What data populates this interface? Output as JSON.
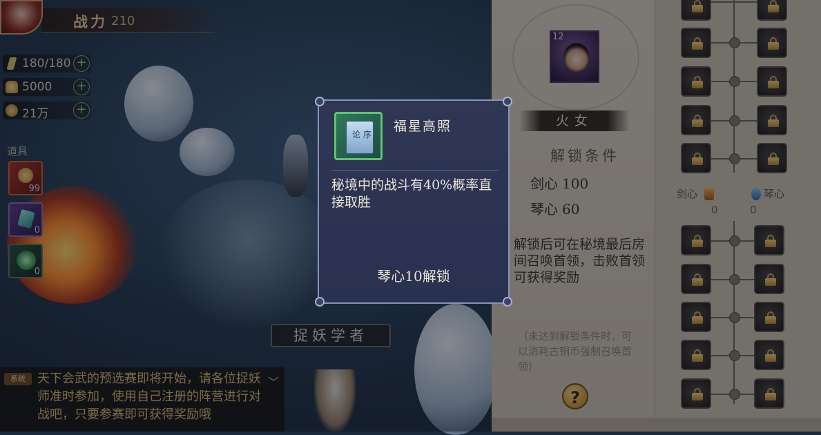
{
  "hud": {
    "power_label": "战力",
    "power_value": "210",
    "stamina": "180/180",
    "gold": "5000",
    "coins": "21万",
    "plus": "+"
  },
  "items": {
    "label": "道具",
    "slots": [
      {
        "count": "99"
      },
      {
        "count": "0"
      },
      {
        "count": "0"
      }
    ]
  },
  "npc": {
    "name": "捉妖学者"
  },
  "chat": {
    "tag": "系统",
    "text": "天下会武的预选赛即将开始，请各位捉妖师准时参加，使用自己注册的阵营进行对战吧，只要参赛即可获得奖励哦",
    "collapse": "﹀"
  },
  "panel": {
    "boss_level": "12",
    "boss_name": "火女",
    "unlock_title": "解锁条件",
    "requirements": [
      {
        "name": "剑心",
        "value": "100"
      },
      {
        "name": "琴心",
        "value": "60"
      }
    ],
    "description": "解锁后可在秘境最后房间召唤首领，击败首领可获得奖励",
    "note": "（未达到解锁条件时，可以消耗古铜币强制召唤首领）",
    "help": "?"
  },
  "tree": {
    "left_branch": {
      "label": "剑心",
      "count": "0"
    },
    "right_branch": {
      "label": "琴心",
      "count": "0"
    }
  },
  "tooltip": {
    "book_label": "论 序",
    "title": "福星高照",
    "description": "秘境中的战斗有40%概率直接取胜",
    "unlock": "琴心10解锁"
  },
  "colors": {
    "panel_bg": "#c9bfae",
    "tooltip_bg": "#2f3755",
    "accent_gold": "#e5c792",
    "rare_green": "#5ec46e"
  }
}
